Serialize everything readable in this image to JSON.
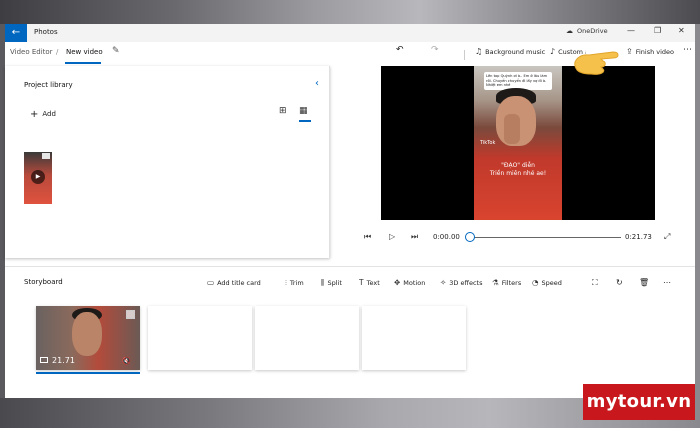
{
  "titlebar": {
    "app_title": "Photos",
    "onedrive_label": "OneDrive",
    "back_icon": "arrow-left-icon",
    "minimize_icon": "minimize-icon",
    "maximize_icon": "maximize-icon",
    "close_icon": "close-icon"
  },
  "breadcrumb": {
    "parent": "Video Editor",
    "current": "New video",
    "rename_icon": "pencil-icon"
  },
  "toolbar": {
    "undo_icon": "undo-icon",
    "redo_icon": "redo-icon",
    "background_music": "Background music",
    "custom_audio": "Custom audio",
    "finish_video": "Finish video",
    "more_icon": "more-icon"
  },
  "library": {
    "title": "Project library",
    "add_label": "Add",
    "collapse_icon": "chevron-left-icon",
    "grid_large_icon": "grid-large-icon",
    "grid_small_icon": "grid-small-icon"
  },
  "preview": {
    "caption_top": "Lên top Quỳnh ơi à.. Em ở lâu làm rồi. Chuyển chuyển đi lấy vợ đi à. Nhiệt em nhé",
    "caption_line1": "\"ĐẠO\" diễn",
    "caption_line2": "Triền miên nhé ae!",
    "tiktok": "TikTok"
  },
  "playback": {
    "current_time": "0:00.00",
    "total_time": "0:21.73",
    "progress": 0,
    "rewind_icon": "skip-back-icon",
    "play_icon": "play-icon",
    "forward_icon": "skip-forward-icon",
    "fullscreen_icon": "expand-icon"
  },
  "storyboard": {
    "title": "Storyboard",
    "tools": {
      "add_title_card": "Add title card",
      "trim": "Trim",
      "split": "Split",
      "text": "Text",
      "motion": "Motion",
      "effects_3d": "3D effects",
      "filters": "Filters",
      "speed": "Speed"
    },
    "clip_duration": "21.71"
  },
  "watermark": "mytour.vn"
}
